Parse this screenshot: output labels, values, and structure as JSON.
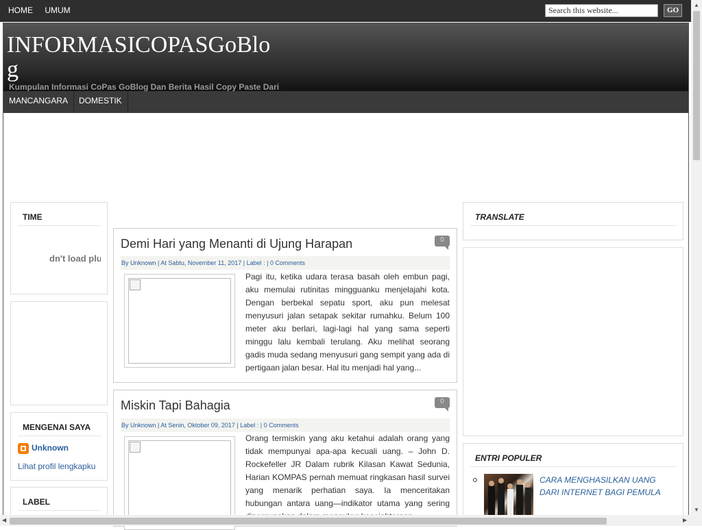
{
  "topnav": {
    "items": [
      "HOME",
      "UMUM"
    ],
    "search_placeholder": "Search this website...",
    "go_label": "GO"
  },
  "header": {
    "title": "INFORMASICOPASGoBlog",
    "tagline": "Kumpulan Informasi CoPas GoBlog Dan Berita Hasil Copy Paste Dari"
  },
  "catnav": {
    "items": [
      "MANCANGARA",
      "DOMESTIK"
    ]
  },
  "left": {
    "time_title": "TIME",
    "time_message": "dn't load plu",
    "about_title": "MENGENAI SAYA",
    "about_name": "Unknown",
    "about_link": "Lihat profil lengkapku",
    "label_title": "LABEL"
  },
  "posts": [
    {
      "title": "Demi Hari yang Menanti di Ujung Harapan",
      "comments": "0",
      "meta": "By Unknown | At Sabtu, November 11, 2017 | Label : | 0 Comments",
      "excerpt": "Pagi itu, ketika udara terasa basah oleh embun pagi, aku memulai rutinitas mingguanku menjelajahi kota. Dengan berbekal sepatu sport, aku pun melesat menyusuri jalan setapak sekitar rumahku. Belum 100 meter aku berlari, lagi-lagi hal yang sama seperti minggu lalu kembali terulang. Aku melihat seorang gadis muda sedang menyusuri gang sempit yang ada di pertigaan jalan besar. Hal itu menjadi hal yang..."
    },
    {
      "title": "Miskin Tapi Bahagia",
      "comments": "0",
      "meta": "By Unknown | At Senin, Oktober 09, 2017 | Label : | 0 Comments",
      "excerpt": "Orang termiskin yang aku ketahui adalah orang yang tidak mempunyai apa-apa kecuali uang. – John D. Rockefeller JR Dalam rubrik Kilasan Kawat Sedunia, Harian KOMPAS pernah memuat ringkasan hasil survei yang menarik perhatian saya. Ia menceritakan hubungan antara uang—indikator utama yang sering dipergunakan dalam mengukur kesejahteraan"
    }
  ],
  "right": {
    "translate_title": "TRANSLATE",
    "popular_title": "ENTRI POPULER",
    "popular_items": [
      "CARA MENGHASILKAN UANG DARI INTERNET BAGI PEMULA"
    ]
  },
  "colors": {
    "link": "#2a5e9a",
    "header_dark": "#2e2e2e",
    "blogger_orange": "#f57d00"
  }
}
